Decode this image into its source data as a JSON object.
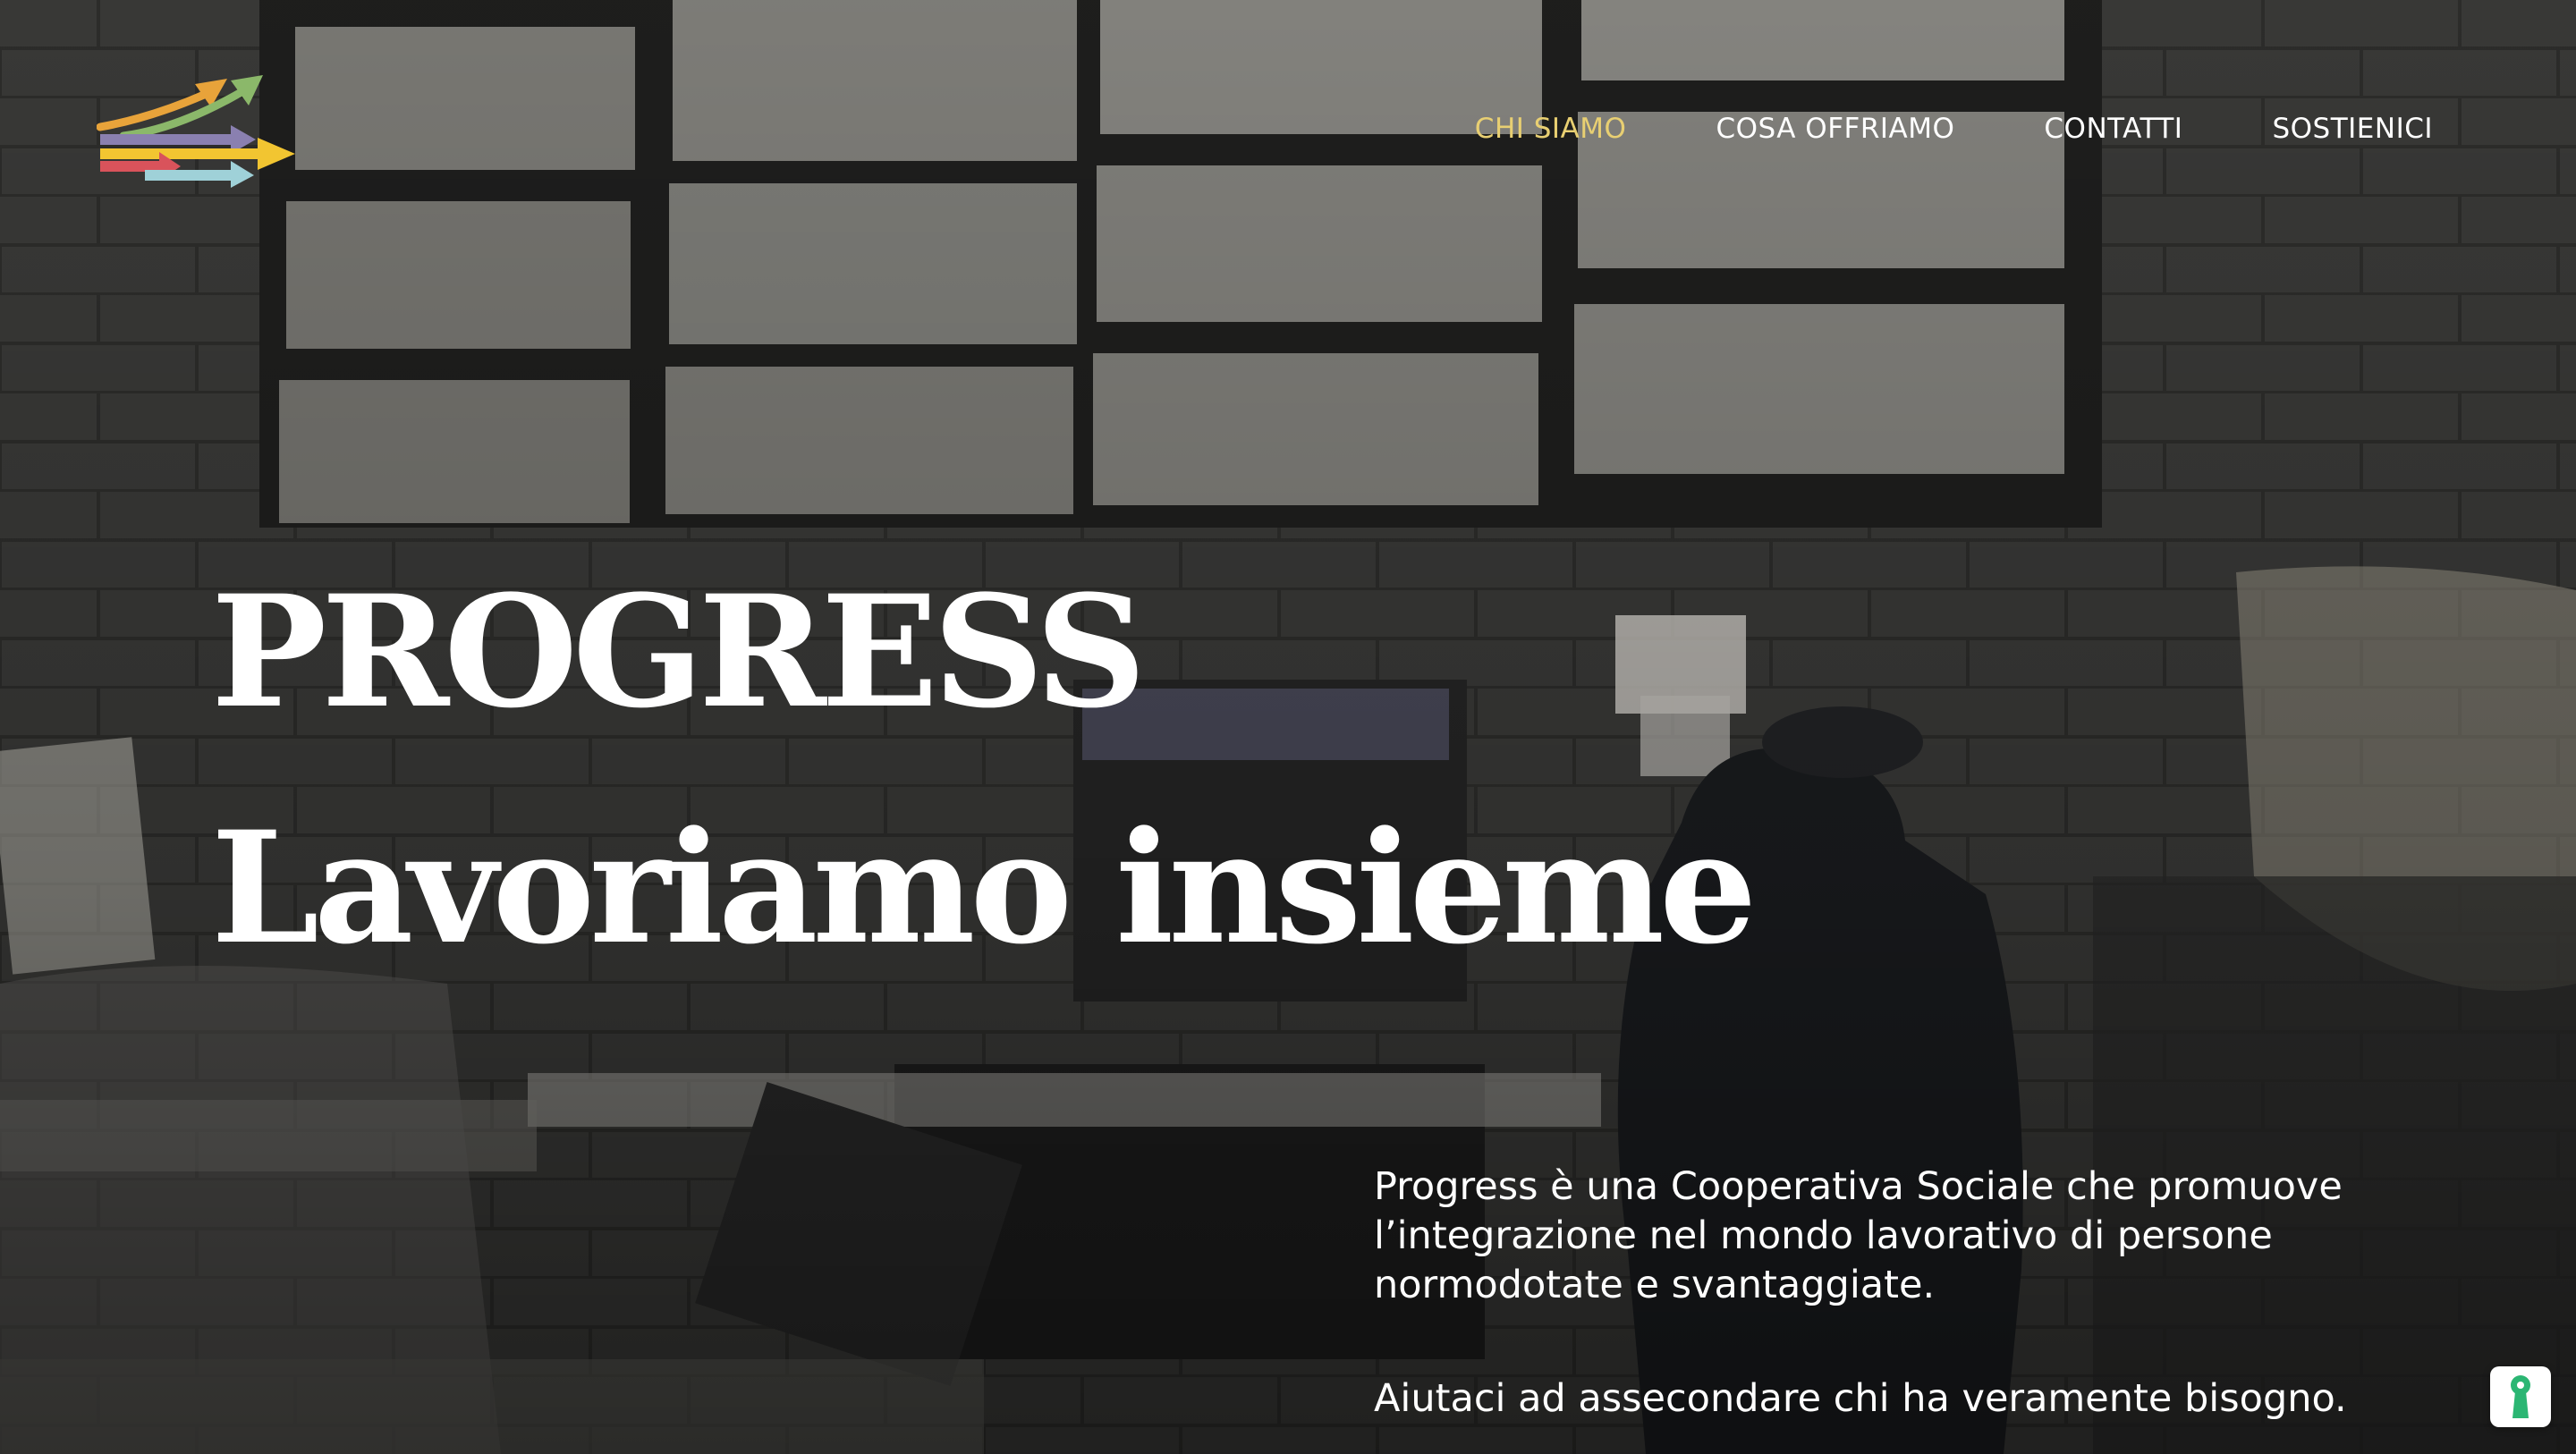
{
  "brand": {
    "logo_icon": "arrows-logo-icon",
    "colors": [
      "#e8a33a",
      "#8bb86a",
      "#8a80b0",
      "#d9535b",
      "#9fd1d8",
      "#f2c531"
    ]
  },
  "nav": {
    "items": [
      {
        "label": "CHI SIAMO",
        "active": true
      },
      {
        "label": "COSA OFFRIAMO",
        "active": false
      },
      {
        "label": "CONTATTI",
        "active": false
      },
      {
        "label": "SOSTIENICI",
        "active": false
      }
    ],
    "active_color": "#e8cf72"
  },
  "hero": {
    "title": "PROGRESS",
    "subtitle": "Lavoriamo insieme"
  },
  "intro": {
    "paragraph1": "Progress è una Cooperativa Sociale che promuove l’integrazione nel mondo lavorativo di persone normodotate e svantaggiate.",
    "paragraph2": "Aiutaci ad assecondare chi ha veramente bisogno."
  },
  "cookie": {
    "icon": "keyhole-icon",
    "accent": "#2bb673"
  }
}
